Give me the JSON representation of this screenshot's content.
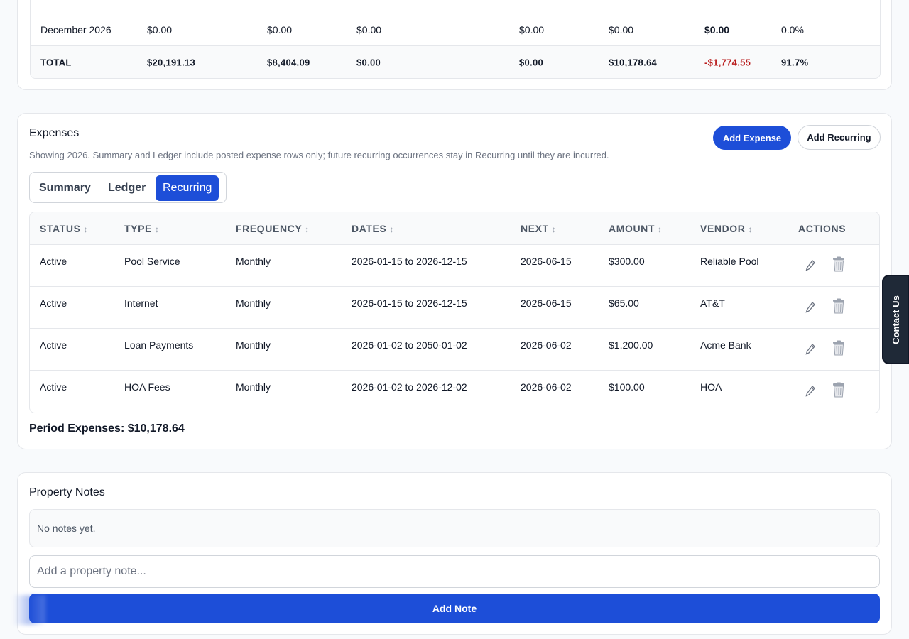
{
  "income_table": {
    "ghost_row": {
      "label": "",
      "c1": "$",
      "c2": "$",
      "c3": "$",
      "c4": "$",
      "c5": "$",
      "c6": "$",
      "c7": ""
    },
    "rows": [
      {
        "month": "December 2026",
        "c1": "$0.00",
        "c2": "$0.00",
        "c3": "$0.00",
        "c4": "$0.00",
        "c5": "$0.00",
        "c6": "$0.00",
        "c7": "0.0%"
      }
    ],
    "total": {
      "label": "TOTAL",
      "c1": "$20,191.13",
      "c2": "$8,404.09",
      "c3": "$0.00",
      "c4": "$0.00",
      "c5": "$10,178.64",
      "c6": "-$1,774.55",
      "c7": "91.7%"
    }
  },
  "expenses": {
    "title": "Expenses",
    "subtitle": "Showing 2026. Summary and Ledger include posted expense rows only; future recurring occurrences stay in Recurring until they are incurred.",
    "add_expense_label": "Add Expense",
    "add_recurring_label": "Add Recurring",
    "tabs": [
      {
        "label": "Summary",
        "active": false
      },
      {
        "label": "Ledger",
        "active": false
      },
      {
        "label": "Recurring",
        "active": true
      }
    ],
    "columns": {
      "status": "STATUS",
      "type": "TYPE",
      "frequency": "FREQUENCY",
      "dates": "DATES",
      "next": "NEXT",
      "amount": "AMOUNT",
      "vendor": "VENDOR",
      "actions": "ACTIONS",
      "sort_glyph": "↕"
    },
    "rows": [
      {
        "status": "Active",
        "type": "Pool Service",
        "frequency": "Monthly",
        "dates": "2026-01-15 to 2026-12-15",
        "next": "2026-06-15",
        "amount": "$300.00",
        "vendor": "Reliable Pool"
      },
      {
        "status": "Active",
        "type": "Internet",
        "frequency": "Monthly",
        "dates": "2026-01-15 to 2026-12-15",
        "next": "2026-06-15",
        "amount": "$65.00",
        "vendor": "AT&T"
      },
      {
        "status": "Active",
        "type": "Loan Payments",
        "frequency": "Monthly",
        "dates": "2026-01-02 to 2050-01-02",
        "next": "2026-06-02",
        "amount": "$1,200.00",
        "vendor": "Acme Bank"
      },
      {
        "status": "Active",
        "type": "HOA Fees",
        "frequency": "Monthly",
        "dates": "2026-01-02 to 2026-12-02",
        "next": "2026-06-02",
        "amount": "$100.00",
        "vendor": "HOA"
      }
    ],
    "period_label": "Period Expenses:",
    "period_value": "$10,178.64"
  },
  "notes": {
    "title": "Property Notes",
    "empty_text": "No notes yet.",
    "input_placeholder": "Add a property note...",
    "add_label": "Add Note"
  },
  "contact_tab_label": "Contact Us",
  "colors": {
    "primary": "#1d4ed8",
    "negative": "#b91c1c",
    "border": "#e5e7eb",
    "muted_text": "#6b7280"
  }
}
